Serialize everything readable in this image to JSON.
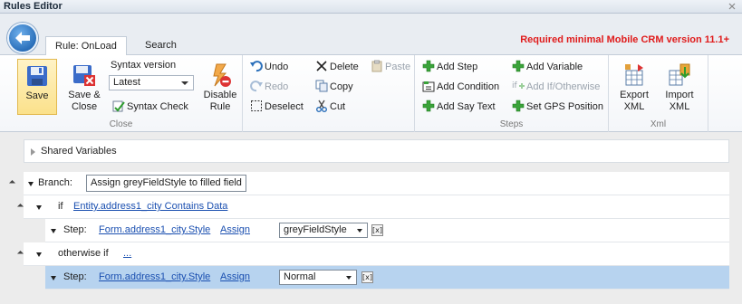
{
  "window": {
    "title": "Rules Editor"
  },
  "header": {
    "tabs": [
      {
        "label": "Rule: OnLoad"
      },
      {
        "label": "Search"
      }
    ],
    "notice": "Required minimal Mobile CRM version 11.1+"
  },
  "ribbon": {
    "close_group": {
      "label": "Close",
      "save": "Save",
      "save_close_line1": "Save &",
      "save_close_line2": "Close",
      "syntax_version_label": "Syntax version",
      "syntax_version_value": "Latest",
      "syntax_check": "Syntax Check",
      "disable_rule_line1": "Disable",
      "disable_rule_line2": "Rule"
    },
    "edit_group": {
      "undo": "Undo",
      "redo": "Redo",
      "deselect": "Deselect",
      "delete": "Delete",
      "copy": "Copy",
      "cut": "Cut",
      "paste": "Paste"
    },
    "steps_group": {
      "label": "Steps",
      "add_step": "Add Step",
      "add_condition": "Add Condition",
      "add_say_text": "Add Say Text",
      "add_variable": "Add Variable",
      "add_if_otherwise": "Add If/Otherwise",
      "set_gps_position": "Set GPS Position"
    },
    "xml_group": {
      "label": "Xml",
      "export_line1": "Export",
      "export_line2": "XML",
      "import_line1": "Import",
      "import_line2": "XML"
    }
  },
  "tree": {
    "shared_variables": "Shared Variables",
    "branch_label": "Branch:",
    "branch_name": "Assign greyFieldStyle to filled field",
    "if_label": "if",
    "if_condition": "Entity.address1_city Contains Data",
    "step1": {
      "label": "Step:",
      "target": "Form.address1_city.Style",
      "op": "Assign",
      "value": "greyFieldStyle",
      "clear": "[x]"
    },
    "otherwise_label": "otherwise if",
    "otherwise_condition": "...",
    "step2": {
      "label": "Step:",
      "target": "Form.address1_city.Style",
      "op": "Assign",
      "value": "Normal",
      "clear": "[x]"
    }
  }
}
